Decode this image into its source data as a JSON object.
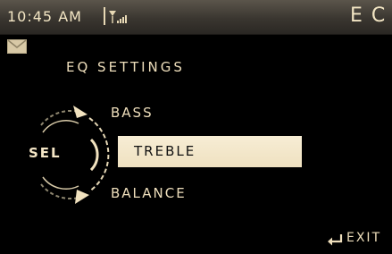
{
  "status_bar": {
    "time": "10:45 AM",
    "title": "EC",
    "signal_icon": "signal-strength-icon"
  },
  "notification": {
    "icon": "mail-icon"
  },
  "eq_menu": {
    "heading": "EQ SETTINGS",
    "selector_label": "SEL",
    "items": [
      {
        "label": "BASS",
        "selected": false
      },
      {
        "label": "TREBLE",
        "selected": true
      },
      {
        "label": "BALANCE",
        "selected": false
      }
    ]
  },
  "footer": {
    "exit_label": "EXIT",
    "exit_icon": "enter-return-icon"
  },
  "colors": {
    "text": "#efdfbc",
    "highlight": "#f7edd5",
    "status_bg": "#4b463f"
  }
}
